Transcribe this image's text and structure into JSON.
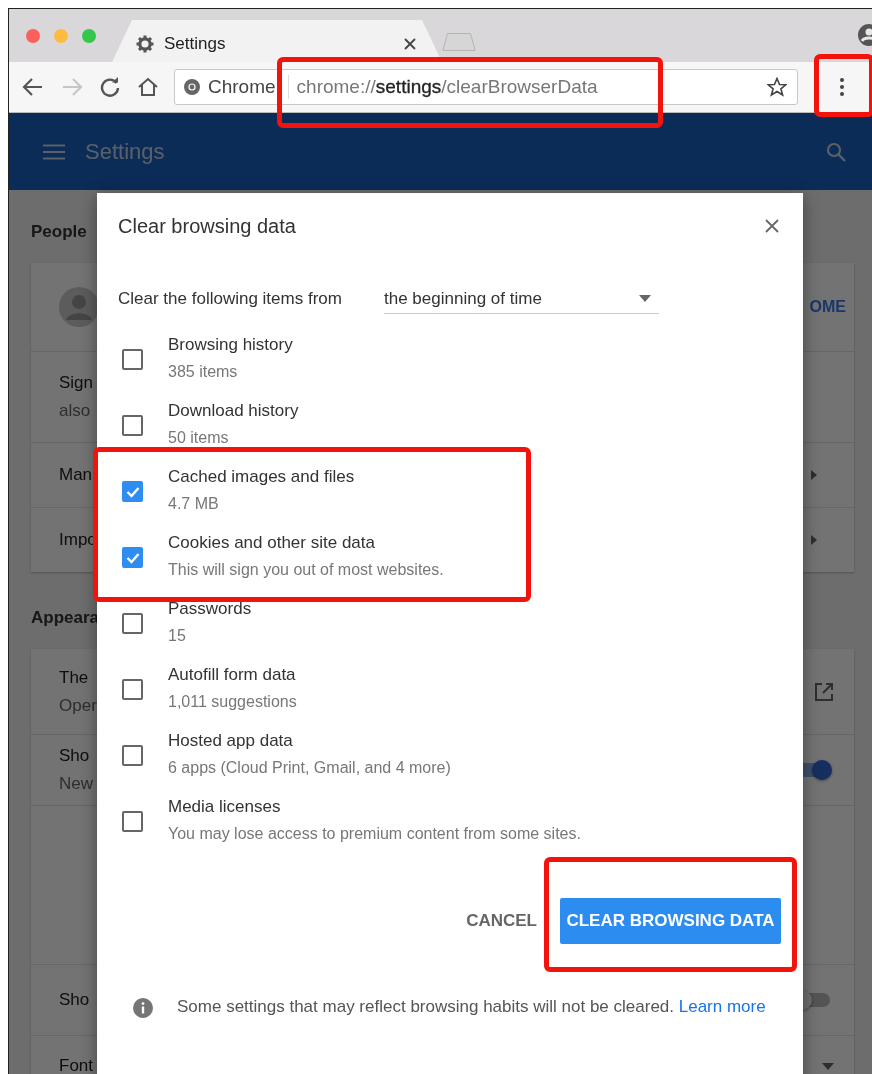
{
  "browser": {
    "tab": {
      "title": "Settings",
      "selected": true
    },
    "nav": {
      "forward_disabled": true
    },
    "omnibox": {
      "site_chip": "Chrome",
      "url": "chrome://**settings**/clearBrowserData",
      "highlighted": true
    },
    "menu_button": {
      "highlighted": true
    }
  },
  "settings_page": {
    "header_title": "Settings",
    "sections": [
      {
        "title": "People",
        "rows": [
          {
            "kind": "profile",
            "action": "OME"
          },
          {
            "kind": "text",
            "lines": [
              "Sign",
              "also"
            ]
          },
          {
            "kind": "link",
            "lines": [
              "Man"
            ]
          },
          {
            "kind": "link",
            "lines": [
              "Impo"
            ]
          }
        ]
      },
      {
        "title": "Appeara",
        "rows": [
          {
            "kind": "external",
            "lines": [
              "The",
              "Oper"
            ]
          },
          {
            "kind": "toggle",
            "lines": [
              "Sho",
              "New"
            ],
            "on": true
          },
          {
            "kind": "blank"
          },
          {
            "kind": "toggle",
            "lines": [
              "Sho"
            ],
            "on": false
          },
          {
            "kind": "dropdown",
            "lines": [
              "Font"
            ]
          }
        ]
      }
    ]
  },
  "dialog": {
    "title": "Clear browsing data",
    "range_label": "Clear the following items from",
    "range_value": "the beginning of time",
    "items": [
      {
        "label": "Browsing history",
        "detail": "385 items",
        "checked": false,
        "highlighted": false
      },
      {
        "label": "Download history",
        "detail": "50 items",
        "checked": false,
        "highlighted": false
      },
      {
        "label": "Cached images and files",
        "detail": "4.7 MB",
        "checked": true,
        "highlighted": true
      },
      {
        "label": "Cookies and other site data",
        "detail": "This will sign you out of most websites.",
        "checked": true,
        "highlighted": true
      },
      {
        "label": "Passwords",
        "detail": "15",
        "checked": false,
        "highlighted": false
      },
      {
        "label": "Autofill form data",
        "detail": "1,011 suggestions",
        "checked": false,
        "highlighted": false
      },
      {
        "label": "Hosted app data",
        "detail": "6 apps (Cloud Print, Gmail, and 4 more)",
        "checked": false,
        "highlighted": false
      },
      {
        "label": "Media licenses",
        "detail": "You may lose access to premium content from some sites.",
        "checked": false,
        "highlighted": false
      }
    ],
    "cancel_button": "CANCEL",
    "confirm_button": {
      "label": "CLEAR BROWSING DATA",
      "highlighted": true
    },
    "footer_note": "Some settings that may reflect browsing habits will not be cleared.",
    "footer_link": "Learn more"
  }
}
